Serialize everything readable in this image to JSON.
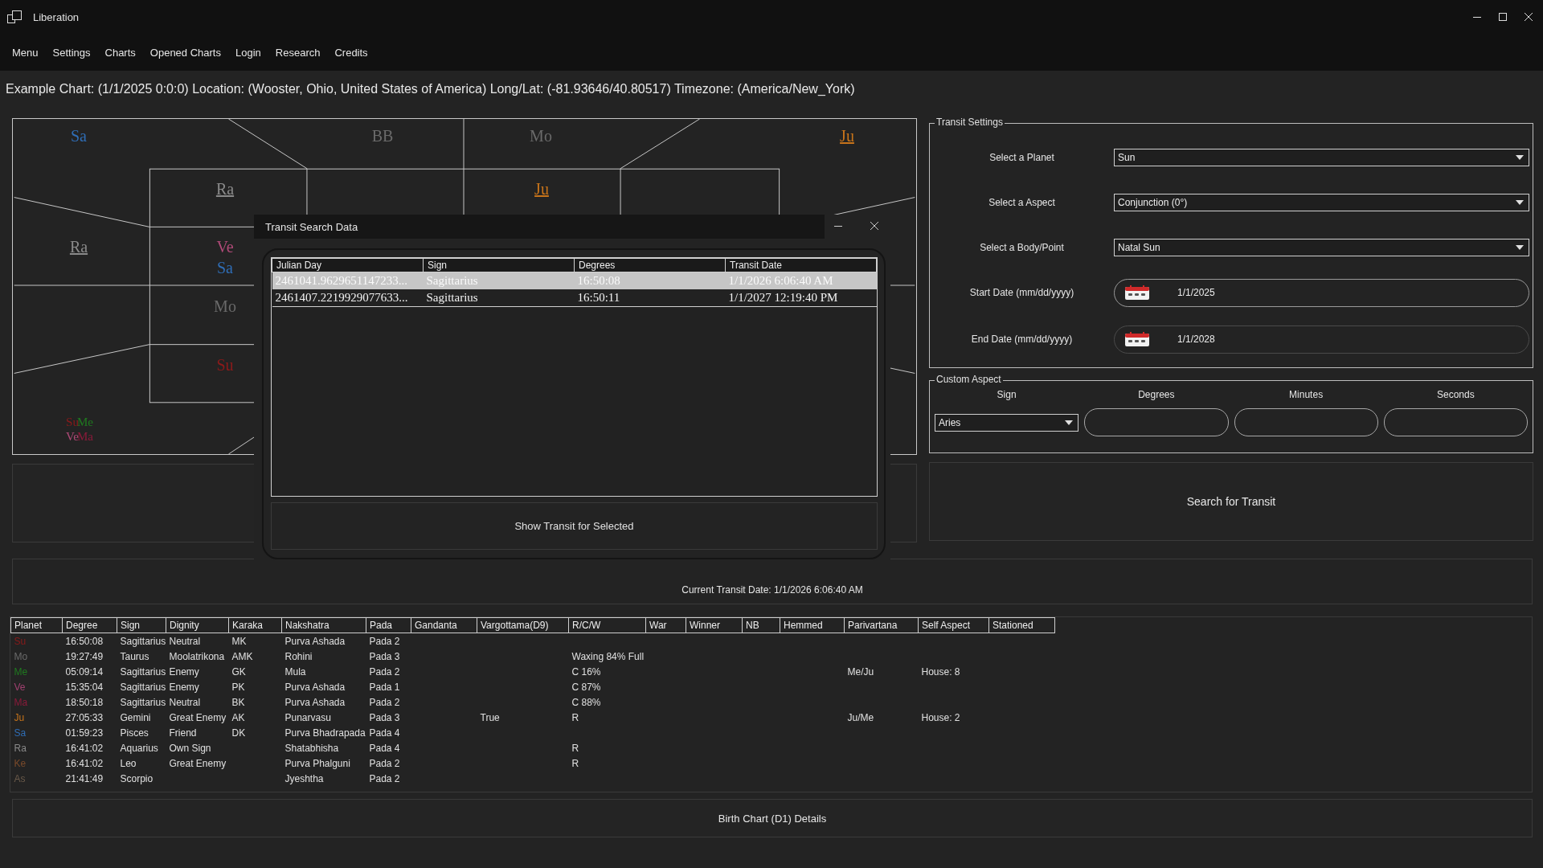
{
  "window": {
    "title": "Liberation"
  },
  "menu": [
    "Menu",
    "Settings",
    "Charts",
    "Opened Charts",
    "Login",
    "Research",
    "Credits"
  ],
  "chart_info": "Example Chart: (1/1/2025 0:0:0) Location: (Wooster, Ohio, United States of America) Long/Lat: (-81.93646/40.80517) Timezone: (America/New_York)",
  "chart": {
    "labels": [
      {
        "text": "Sa",
        "color": "#2f6db5",
        "underlined": false
      },
      {
        "text": "BB",
        "color": "#6a6a6a",
        "underlined": false
      },
      {
        "text": "Mo",
        "color": "#6a6a6a",
        "underlined": false
      },
      {
        "text": "Ju",
        "color": "#c8741a",
        "underlined": true
      },
      {
        "text": "Ra",
        "color": "#8a8a8a",
        "underlined": true
      },
      {
        "text": "Ju",
        "color": "#c8741a",
        "underlined": true
      },
      {
        "text": "Ra",
        "color": "#8a8a8a",
        "underlined": true
      },
      {
        "text": "Ve",
        "color": "#b04a78",
        "underlined": false
      },
      {
        "text": "Sa",
        "color": "#2f6db5",
        "underlined": false
      },
      {
        "text": "Mo",
        "color": "#6a6a6a",
        "underlined": false
      },
      {
        "text": "Su",
        "color": "#8b1a1a",
        "underlined": false
      },
      {
        "text": "Su",
        "color": "#8b1a1a",
        "underlined": false
      },
      {
        "text": "Me",
        "color": "#1f7a1f",
        "underlined": false
      },
      {
        "text": "Ve",
        "color": "#b04a78",
        "underlined": false
      },
      {
        "text": "Ma",
        "color": "#8b1a3a",
        "underlined": false
      }
    ]
  },
  "transit_settings": {
    "title": "Transit Settings",
    "fields": [
      {
        "kind": "select",
        "label": "Select a Planet",
        "value": "Sun"
      },
      {
        "kind": "select",
        "label": "Select a Aspect",
        "value": "Conjunction (0°)"
      },
      {
        "kind": "select",
        "label": "Select a Body/Point",
        "value": "Natal Sun"
      },
      {
        "kind": "date",
        "label": "Start Date (mm/dd/yyyy)",
        "value": "1/1/2025"
      },
      {
        "kind": "date",
        "label": "End Date (mm/dd/yyyy)",
        "value": "1/1/2028"
      }
    ]
  },
  "custom_aspect": {
    "title": "Custom Aspect",
    "sign": {
      "label": "Sign",
      "value": "Aries"
    },
    "inputs": [
      {
        "label": "Degrees"
      },
      {
        "label": "Minutes"
      },
      {
        "label": "Seconds"
      }
    ]
  },
  "search_button": "Search for Transit",
  "current_transit": "Current Transit Date: 1/1/2026 6:06:40 AM",
  "planet_table": {
    "columns": [
      "Planet",
      "Degree",
      "Sign",
      "Dignity",
      "Karaka",
      "Nakshatra",
      "Pada",
      "Gandanta",
      "Vargottama(D9)",
      "R/C/W",
      "War",
      "Winner",
      "NB",
      "Hemmed",
      "Parivartana",
      "Self Aspect",
      "Stationed"
    ],
    "rows": [
      {
        "color": "#8b1a1a",
        "planet": "Su",
        "degree": "16:50:08",
        "sign": "Sagittarius",
        "dignity": "Neutral",
        "karaka": "MK",
        "nakshatra": "Purva Ashada",
        "pada": "Pada 2"
      },
      {
        "color": "#6a6a6a",
        "planet": "Mo",
        "degree": "19:27:49",
        "sign": "Taurus",
        "dignity": "Moolatrikona",
        "karaka": "AMK",
        "nakshatra": "Rohini",
        "pada": "Pada 3",
        "rcw": "Waxing 84% Full"
      },
      {
        "color": "#1f7a1f",
        "planet": "Me",
        "degree": "05:09:14",
        "sign": "Sagittarius",
        "dignity": "Enemy",
        "karaka": "GK",
        "nakshatra": "Mula",
        "pada": "Pada 2",
        "rcw": "C 16%",
        "parivartana": "Me/Ju",
        "self_aspect": "House: 8"
      },
      {
        "color": "#a04070",
        "planet": "Ve",
        "degree": "15:35:04",
        "sign": "Sagittarius",
        "dignity": "Enemy",
        "karaka": "PK",
        "nakshatra": "Purva Ashada",
        "pada": "Pada 1",
        "rcw": "C 87%"
      },
      {
        "color": "#8b1a3a",
        "planet": "Ma",
        "degree": "18:50:18",
        "sign": "Sagittarius",
        "dignity": "Neutral",
        "karaka": "BK",
        "nakshatra": "Purva Ashada",
        "pada": "Pada 2",
        "rcw": "C 88%"
      },
      {
        "color": "#c8741a",
        "planet": "Ju",
        "degree": "27:05:33",
        "sign": "Gemini",
        "dignity": "Great Enemy",
        "karaka": "AK",
        "nakshatra": "Punarvasu",
        "pada": "Pada 3",
        "vargottama": "True",
        "rcw": "R",
        "parivartana": "Ju/Me",
        "self_aspect": "House: 2"
      },
      {
        "color": "#2f6db5",
        "planet": "Sa",
        "degree": "01:59:23",
        "sign": "Pisces",
        "dignity": "Friend",
        "karaka": "DK",
        "nakshatra": "Purva Bhadrapada",
        "pada": "Pada 4"
      },
      {
        "color": "#8a8a8a",
        "planet": "Ra",
        "degree": "16:41:02",
        "sign": "Aquarius",
        "dignity": "Own Sign",
        "nakshatra": "Shatabhisha",
        "pada": "Pada 4",
        "rcw": "R"
      },
      {
        "color": "#7a4a2a",
        "planet": "Ke",
        "degree": "16:41:02",
        "sign": "Leo",
        "dignity": "Great Enemy",
        "nakshatra": "Purva Phalguni",
        "pada": "Pada 2",
        "rcw": "R"
      },
      {
        "color": "#6a5a4a",
        "planet": "As",
        "degree": "21:41:49",
        "sign": "Scorpio",
        "nakshatra": "Jyeshtha",
        "pada": "Pada 2"
      }
    ]
  },
  "details_button": "Birth Chart (D1) Details",
  "dialog": {
    "title": "Transit Search Data",
    "columns": [
      "Julian Day",
      "Sign",
      "Degrees",
      "Transit Date"
    ],
    "rows": [
      {
        "selected": true,
        "cells": [
          "2461041.9629651147233...",
          "Sagittarius",
          "16:50:08",
          "1/1/2026 6:06:40 AM"
        ]
      },
      {
        "selected": false,
        "cells": [
          "2461407.2219929077633...",
          "Sagittarius",
          "16:50:11",
          "1/1/2027 12:19:40 PM"
        ]
      }
    ],
    "button": "Show Transit for Selected"
  }
}
